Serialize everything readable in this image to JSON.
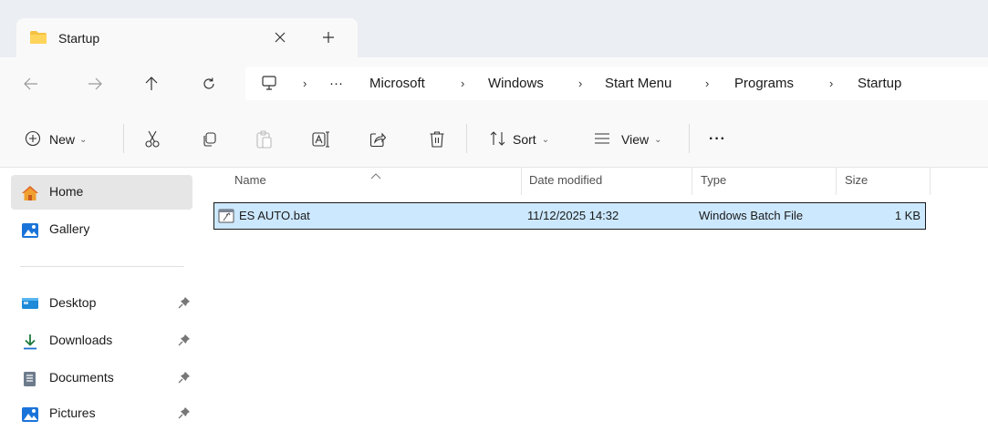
{
  "tab": {
    "title": "Startup"
  },
  "breadcrumbs": [
    {
      "label": "Microsoft"
    },
    {
      "label": "Windows"
    },
    {
      "label": "Start Menu"
    },
    {
      "label": "Programs"
    },
    {
      "label": "Startup"
    }
  ],
  "breadcrumb_overflow": "···",
  "toolbar": {
    "new_label": "New",
    "sort_label": "Sort",
    "view_label": "View",
    "more_label": "···"
  },
  "sidebar": {
    "items": [
      {
        "label": "Home",
        "icon": "home-icon",
        "selected": true
      },
      {
        "label": "Gallery",
        "icon": "gallery-icon"
      },
      {
        "label": "Desktop",
        "icon": "desktop-folder-icon",
        "pinned": true
      },
      {
        "label": "Downloads",
        "icon": "download-icon",
        "pinned": true
      },
      {
        "label": "Documents",
        "icon": "documents-icon",
        "pinned": true
      },
      {
        "label": "Pictures",
        "icon": "pictures-icon",
        "pinned": true
      }
    ]
  },
  "columns": {
    "name": "Name",
    "date": "Date modified",
    "type": "Type",
    "size": "Size"
  },
  "files": [
    {
      "name": "ES AUTO.bat",
      "date": "11/12/2025 14:32",
      "type": "Windows Batch File",
      "size": "1 KB",
      "selected": true
    }
  ],
  "colors": {
    "selection": "#cce8ff",
    "tab_strip": "#ebeef3",
    "folder": "#f5c242",
    "accent": "#0067c0"
  }
}
